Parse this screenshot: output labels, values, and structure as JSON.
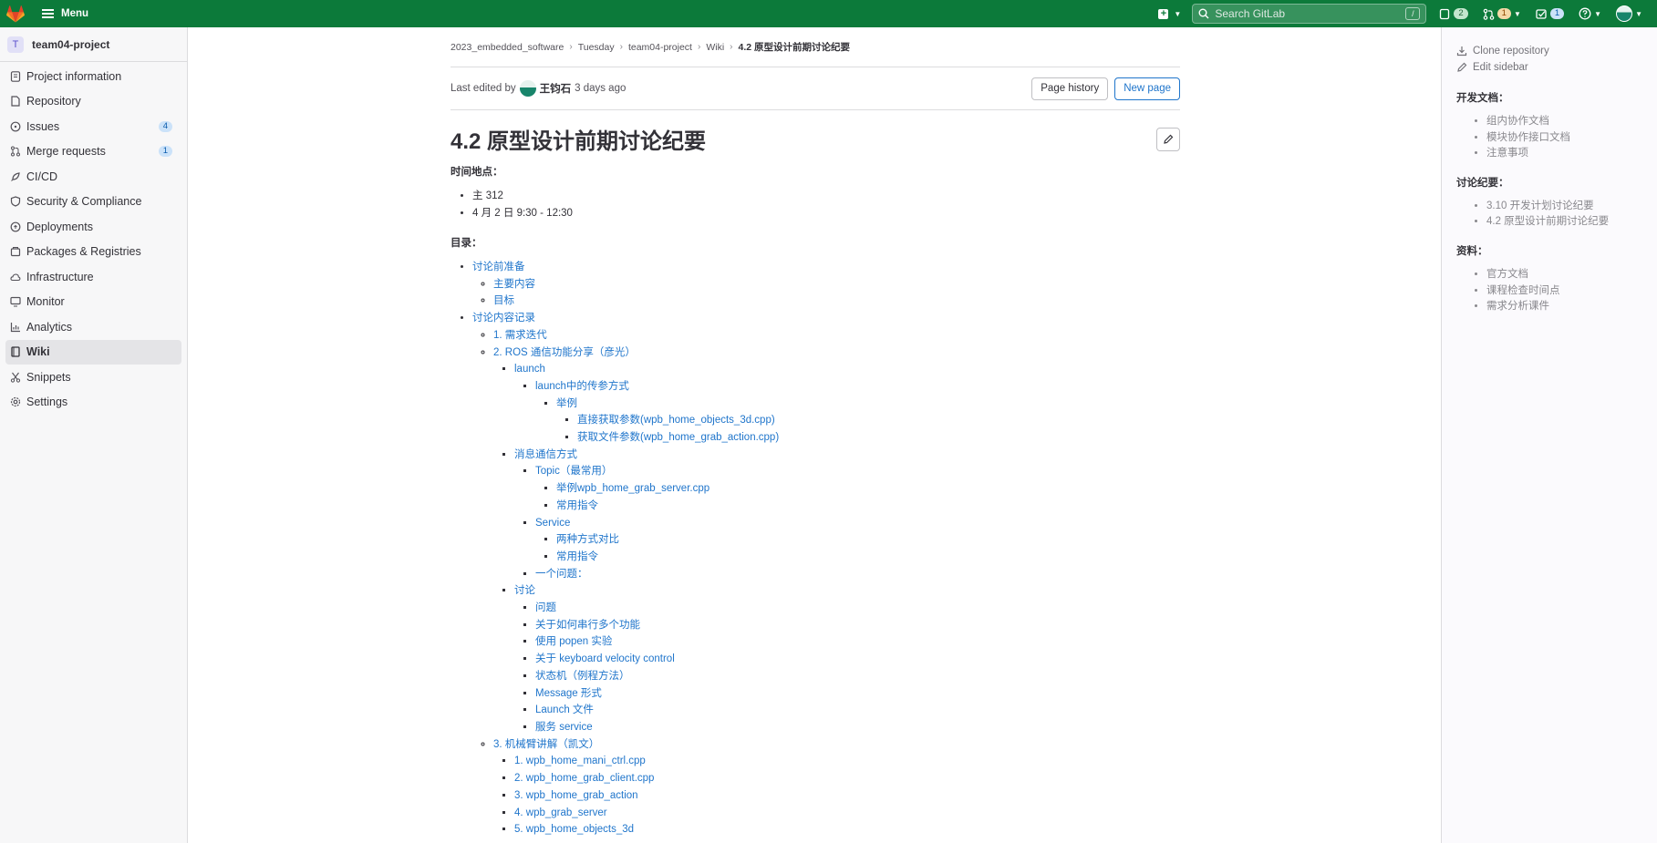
{
  "topbar": {
    "menu_label": "Menu",
    "search_placeholder": "Search GitLab",
    "search_shortcut": "/",
    "issues_count": "2",
    "mr_count": "1",
    "todo_count": "1"
  },
  "sidebar": {
    "project_initial": "T",
    "project_name": "team04-project",
    "items": [
      {
        "label": "Project information",
        "icon": "info-icon"
      },
      {
        "label": "Repository",
        "icon": "doc-icon"
      },
      {
        "label": "Issues",
        "icon": "issues-icon",
        "badge": "4"
      },
      {
        "label": "Merge requests",
        "icon": "merge-request-icon",
        "badge": "1"
      },
      {
        "label": "CI/CD",
        "icon": "rocket-icon"
      },
      {
        "label": "Security & Compliance",
        "icon": "shield-icon"
      },
      {
        "label": "Deployments",
        "icon": "deployments-icon"
      },
      {
        "label": "Packages & Registries",
        "icon": "package-icon"
      },
      {
        "label": "Infrastructure",
        "icon": "cloud-icon"
      },
      {
        "label": "Monitor",
        "icon": "monitor-icon"
      },
      {
        "label": "Analytics",
        "icon": "chart-icon"
      },
      {
        "label": "Wiki",
        "icon": "book-icon"
      },
      {
        "label": "Snippets",
        "icon": "scissors-icon"
      },
      {
        "label": "Settings",
        "icon": "gear-icon"
      }
    ]
  },
  "breadcrumb": [
    "2023_embedded_software",
    "Tuesday",
    "team04-project",
    "Wiki",
    "4.2 原型设计前期讨论纪要"
  ],
  "header": {
    "edited_prefix": "Last edited by",
    "editor": "王钧石",
    "edited_when": "3 days ago",
    "page_history": "Page history",
    "new_page": "New page"
  },
  "page": {
    "title": "4.2 原型设计前期讨论纪要",
    "time_heading": "时间地点：",
    "time_items": [
      "主 312",
      "4 月 2 日 9:30 - 12:30"
    ],
    "toc_heading": "目录：",
    "toc": {
      "t1": "讨论前准备",
      "t1a": "主要内容",
      "t1b": "目标",
      "t2": "讨论内容记录",
      "t2a": "1. 需求迭代",
      "t2b": "2. ROS 通信功能分享（彦光）",
      "launch": "launch",
      "launch_params": "launch中的传参方式",
      "example": "举例",
      "direct_params": "直接获取参数(wpb_home_objects_3d.cpp)",
      "file_params": "获取文件参数(wpb_home_grab_action.cpp)",
      "msg": "消息通信方式",
      "topic": "Topic（最常用）",
      "topic_ex": "举例wpb_home_grab_server.cpp",
      "topic_cmd": "常用指令",
      "service": "Service",
      "compare": "两种方式对比",
      "service_cmd": "常用指令",
      "question": "一个问题：",
      "discuss": "讨论",
      "d1": "问题",
      "d2": "关于如何串行多个功能",
      "d3": "使用 popen 实验",
      "d4": "关于 keyboard velocity control",
      "d5": "状态机（例程方法）",
      "d6": "Message 形式",
      "d7": "Launch 文件",
      "d8": "服务 service",
      "t2c": "3. 机械臂讲解（凯文）",
      "a1": "1. wpb_home_mani_ctrl.cpp",
      "a2": "2. wpb_home_grab_client.cpp",
      "a3": "3. wpb_home_grab_action",
      "a4": "4. wpb_grab_server",
      "a5": "5. wpb_home_objects_3d"
    }
  },
  "right": {
    "clone": "Clone repository",
    "edit_sidebar": "Edit sidebar",
    "s1": "开发文档：",
    "s1_items": [
      "组内协作文档",
      "模块协作接口文档",
      "注意事项"
    ],
    "s2": "讨论纪要：",
    "s2_items": [
      "3.10 开发计划讨论纪要",
      "4.2 原型设计前期讨论纪要"
    ],
    "s3": "资料：",
    "s3_items": [
      "官方文档",
      "课程检查时间点",
      "需求分析课件"
    ]
  }
}
